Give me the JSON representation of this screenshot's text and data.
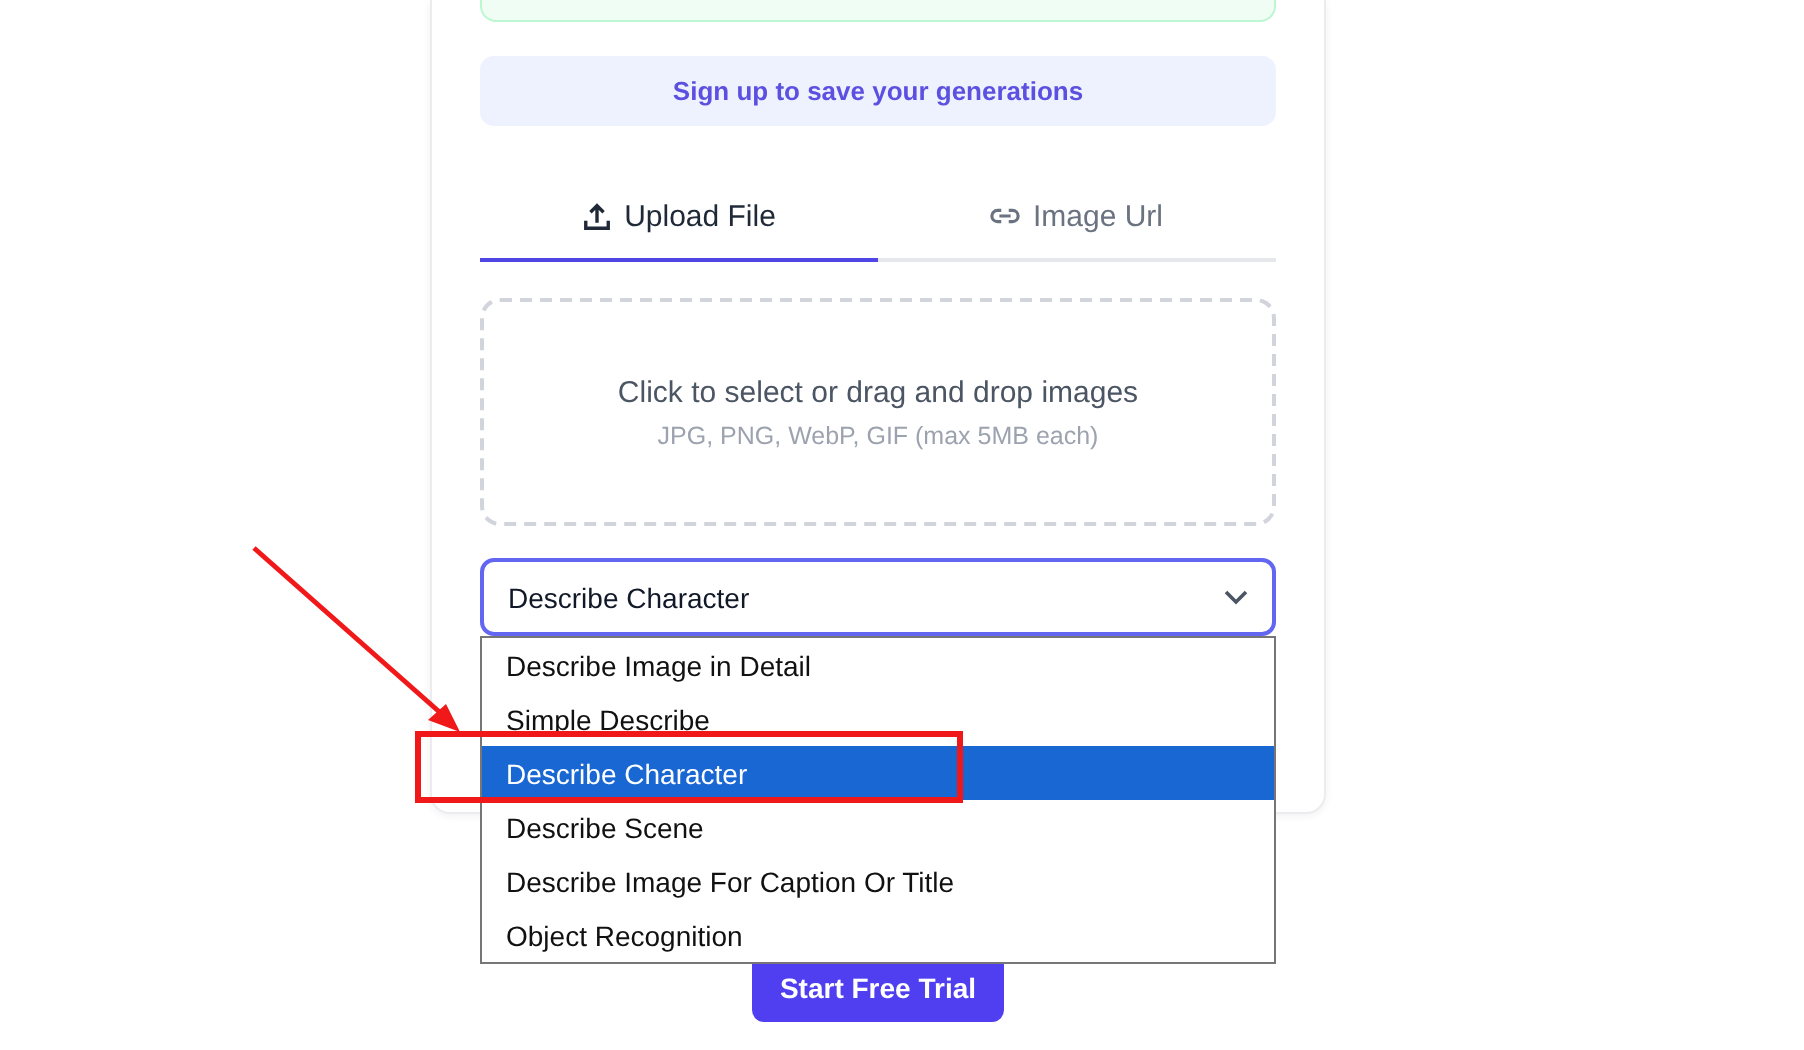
{
  "banner": {
    "text": "Sign up to save your generations"
  },
  "tabs": [
    {
      "label": "Upload File",
      "selected": true
    },
    {
      "label": "Image Url",
      "selected": false
    }
  ],
  "dropzone": {
    "title": "Click to select or drag and drop images",
    "hint": "JPG, PNG, WebP, GIF (max 5MB each)"
  },
  "select": {
    "value": "Describe Character",
    "expanded": true,
    "options": [
      {
        "label": "Describe Image in Detail",
        "selected": false
      },
      {
        "label": "Simple Describe",
        "selected": false
      },
      {
        "label": "Describe Character",
        "selected": true
      },
      {
        "label": "Describe Scene",
        "selected": false
      },
      {
        "label": "Describe Image For Caption Or Title",
        "selected": false
      },
      {
        "label": "Object Recognition",
        "selected": false
      }
    ]
  },
  "cta": {
    "label": "Start Free Trial"
  }
}
